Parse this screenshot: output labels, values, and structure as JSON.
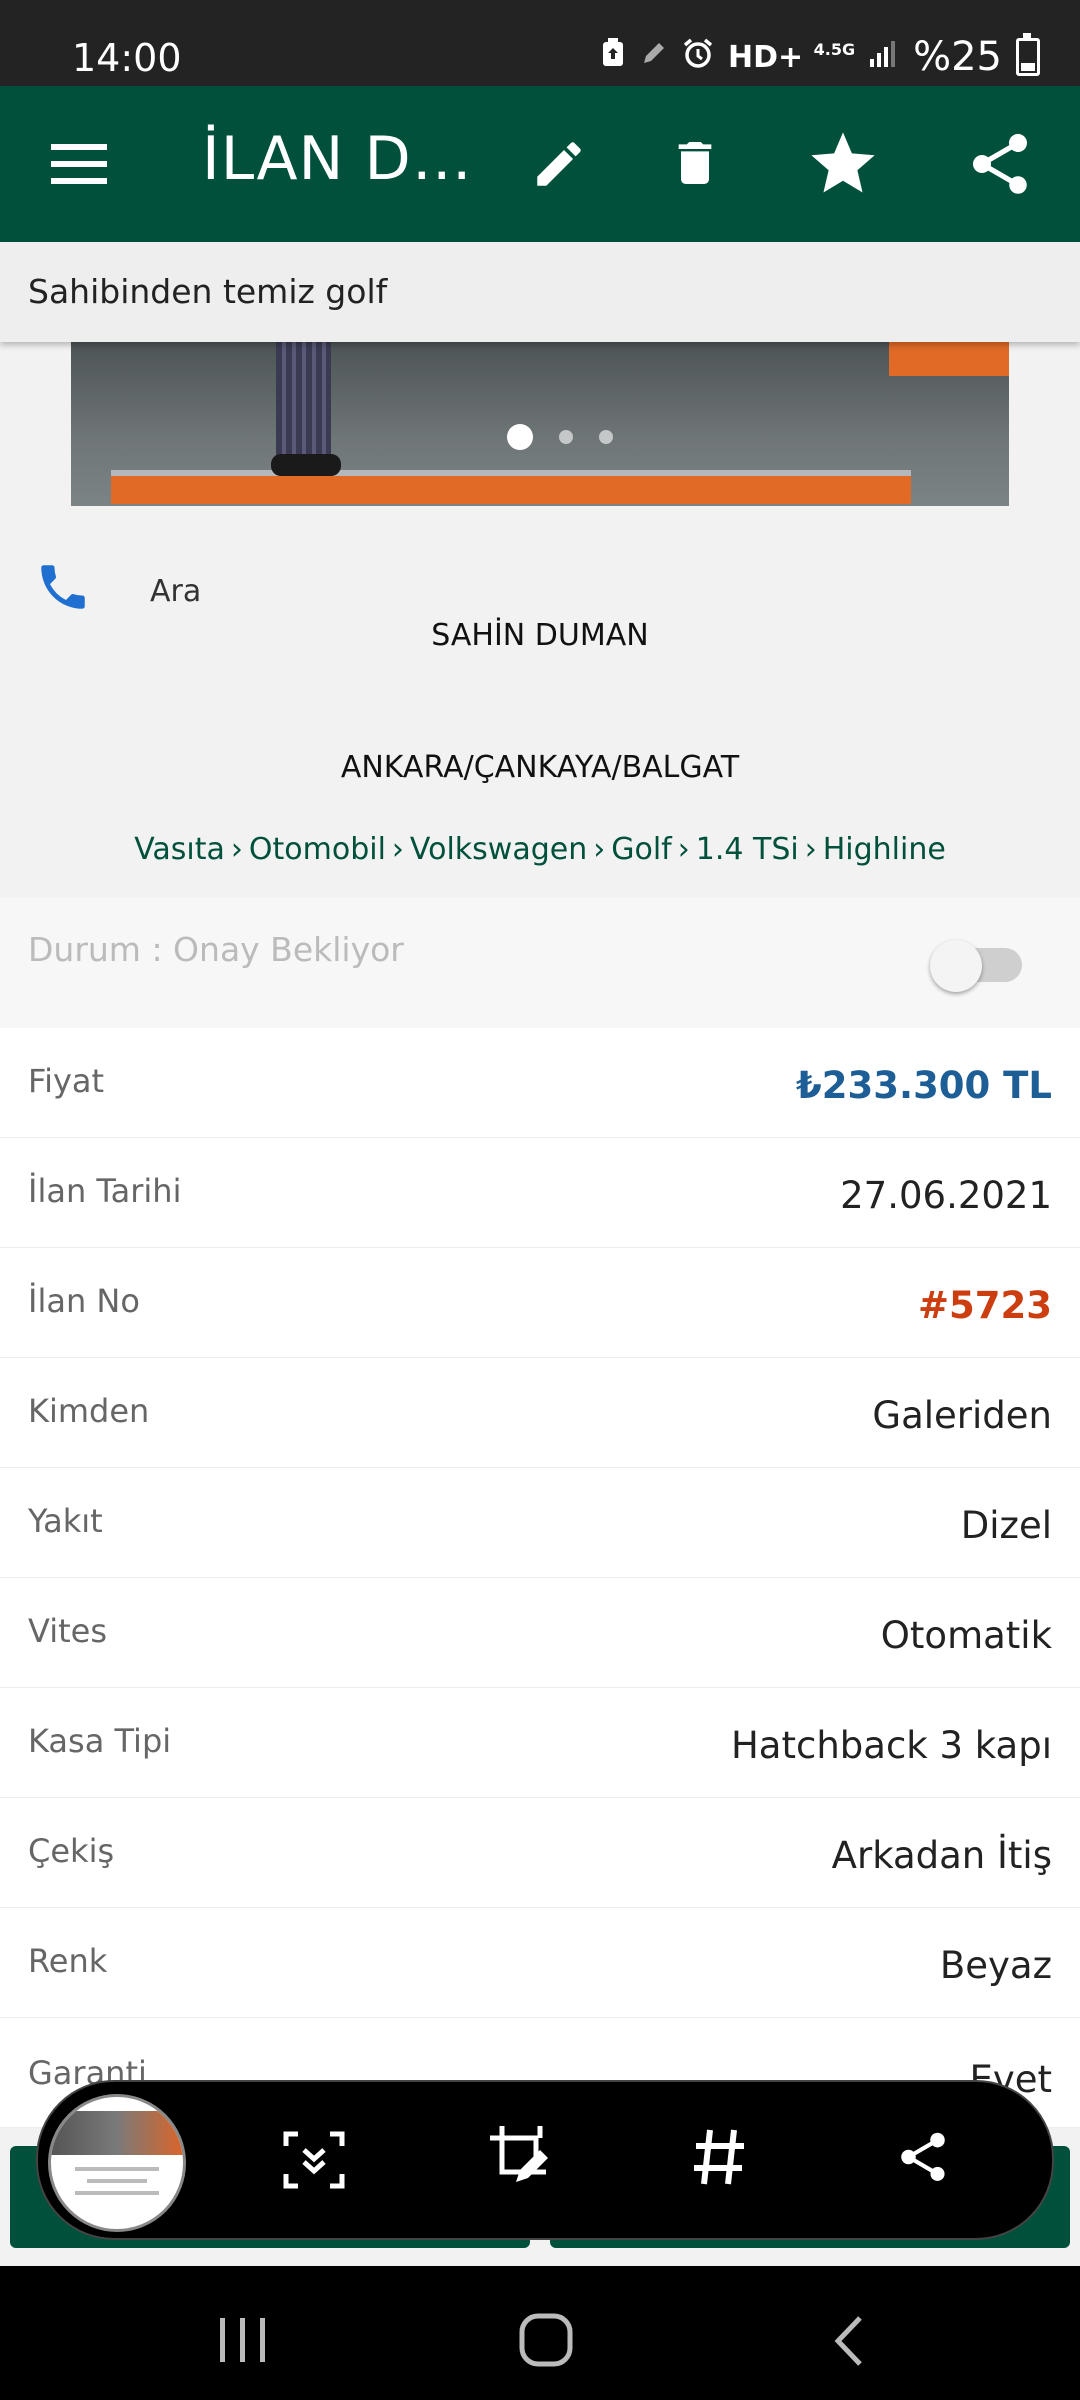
{
  "status_bar": {
    "time": "14:00",
    "network": "HD+",
    "network_small": "4.5G",
    "battery": "%25",
    "battery_level": 0.25,
    "icons": [
      "battery-saver-icon",
      "pen-icon",
      "alarm-icon",
      "signal-icon",
      "battery-icon"
    ]
  },
  "app_bar": {
    "title": "İLAN DET...",
    "icons": [
      "menu-icon",
      "edit-icon",
      "delete-icon",
      "star-icon",
      "share-icon"
    ],
    "background": "#00503c"
  },
  "subheader": {
    "title": "Sahibinden temiz golf"
  },
  "gallery": {
    "pages": 3,
    "active_index": 0
  },
  "contact": {
    "call_label": "Ara",
    "seller_name": "SAHİN DUMAN",
    "location": "ANKARA/ÇANKAYA/BALGAT"
  },
  "breadcrumb": [
    "Vasıta",
    "Otomobil",
    "Volkswagen",
    "Golf",
    "1.4 TSi",
    "Highline"
  ],
  "status": {
    "label": "Durum : Onay Bekliyor",
    "toggle_on": false
  },
  "details": [
    {
      "key": "Fiyat",
      "value": "₺233.300 TL"
    },
    {
      "key": "İlan Tarihi",
      "value": "27.06.2021"
    },
    {
      "key": "İlan No",
      "value": "#5723"
    },
    {
      "key": "Kimden",
      "value": "Galeriden"
    },
    {
      "key": "Yakıt",
      "value": "Dizel"
    },
    {
      "key": "Vites",
      "value": "Otomatik"
    },
    {
      "key": "Kasa Tipi",
      "value": "Hatchback 3 kapı"
    },
    {
      "key": "Çekiş",
      "value": "Arkadan İtiş"
    },
    {
      "key": "Renk",
      "value": "Beyaz"
    },
    {
      "key": "Garanti",
      "value": "Evet"
    }
  ],
  "screenshot_toolbar": {
    "icons": [
      "screenshot-thumbnail",
      "scroll-capture-icon",
      "crop-edit-icon",
      "hashtag-icon",
      "share-icon"
    ]
  },
  "nav_bar": {
    "icons": [
      "recent-apps-icon",
      "home-icon",
      "back-icon"
    ]
  },
  "colors": {
    "primary_green": "#00503c",
    "price_blue": "#1e5e96",
    "ilan_no_red": "#cc3d10"
  }
}
